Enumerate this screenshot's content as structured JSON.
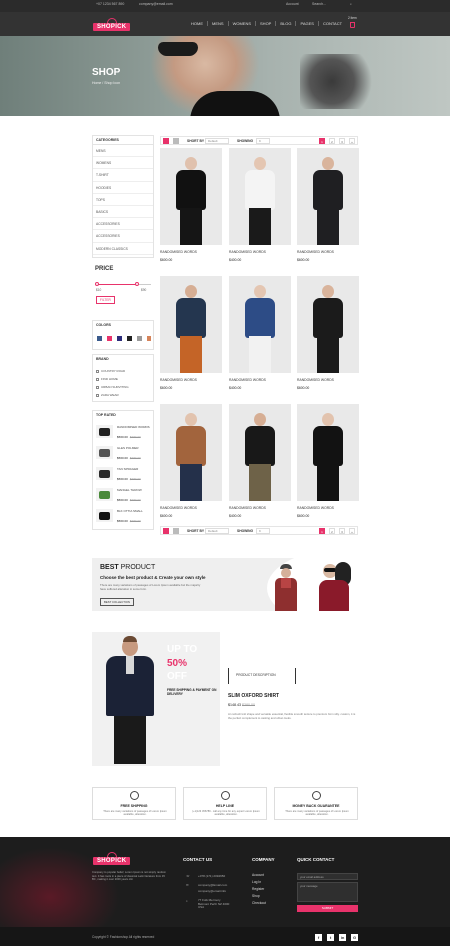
{
  "topbar": {
    "phone": "+07 1234 567 890",
    "email": "company@email.com",
    "account": "Account",
    "search_placeholder": "Search..."
  },
  "header": {
    "logo": "SHOPICK",
    "nav": [
      "HOME",
      "MENS",
      "WOMENS",
      "SHOP",
      "BLOG",
      "PAGES",
      "CONTACT"
    ],
    "cart_count": "2 item"
  },
  "hero": {
    "title": "SHOP",
    "breadcrumb": "Home / Shop Icon"
  },
  "sidebar": {
    "categories_title": "CATEGORIES",
    "categories": [
      "MENS",
      "WOMENS",
      "T-SHIRT",
      "HOODIES",
      "TOPS",
      "BASICS",
      "ACCESSORIES",
      "ACCESSORIES",
      "MODERN CLASSICS"
    ],
    "price_title": "PRICE",
    "price_min": "$10",
    "price_max": "$90",
    "filter_label": "FILTER",
    "colors_title": "COLORS",
    "colors": [
      "#3a5a8c",
      "#e8336b",
      "#2c2c7a",
      "#222222",
      "#9a9a9a",
      "#d5835a"
    ],
    "brand_title": "BRAND",
    "brands": [
      "COUNTRY ROAD",
      "FIND HOME",
      "URBAN SURVITING",
      "ZARA WEAR"
    ],
    "top_rated_title": "TOP RATED",
    "top_rated": [
      {
        "name": "RANDOMISED WORDS",
        "price": "$560.00",
        "old": "$380.00"
      },
      {
        "name": "GLES POLMER",
        "price": "$560.00",
        "old": "$380.00"
      },
      {
        "name": "TAN SPRAGER",
        "price": "$560.00",
        "old": "$380.00"
      },
      {
        "name": "MANGEL THROW",
        "price": "$560.00",
        "old": "$380.00"
      },
      {
        "name": "BLK OTTIA SMALL",
        "price": "$560.00",
        "old": "$380.00"
      }
    ]
  },
  "toolbar": {
    "sort_label": "SHORT BY",
    "sort_value": "Default",
    "show_label": "SHOWING",
    "show_value": "9",
    "pages": [
      "1",
      "2",
      "3",
      "»"
    ]
  },
  "products": [
    {
      "name": "RANDOMISED WORDS",
      "price": "$600.00",
      "body": "#111111",
      "legs": "#151515",
      "skin": "#e0c1ad"
    },
    {
      "name": "RANDOMISED WORDS",
      "price": "$400.00",
      "body": "#f4f4f4",
      "legs": "#1a1a1a",
      "skin": "#e4c6b2"
    },
    {
      "name": "RANDOMISED WORDS",
      "price": "$600.00",
      "body": "#1f1f22",
      "legs": "#1f1f22",
      "skin": "#d9b49c"
    },
    {
      "name": "RANDOMISED WORDS",
      "price": "$600.00",
      "body": "#24364f",
      "legs": "#c46427",
      "skin": "#d6ae94"
    },
    {
      "name": "RANDOMISED WORDS",
      "price": "$400.00",
      "body": "#2d4c86",
      "legs": "#f2f2f2",
      "skin": "#e4c6b2"
    },
    {
      "name": "RANDOMISED WORDS",
      "price": "$600.00",
      "body": "#1b1b1b",
      "legs": "#1b1b1b",
      "skin": "#d9b49c"
    },
    {
      "name": "RANDOMISED WORDS",
      "price": "$600.00",
      "body": "#a2643d",
      "legs": "#24304a",
      "skin": "#e2c3ae"
    },
    {
      "name": "RANDOMISED WORDS",
      "price": "$400.00",
      "body": "#181818",
      "legs": "#6e6248",
      "skin": "#d6ae94"
    },
    {
      "name": "RANDOMISED WORDS",
      "price": "$600.00",
      "body": "#121212",
      "legs": "#121212",
      "skin": "#e2c3ae"
    }
  ],
  "best": {
    "title_bold": "BEST",
    "title_rest": " PRODUCT",
    "subtitle": "Choose the best product & Create your own style",
    "desc": "There are many variations of passages of Lorem Ipsum available but the majority have suffered alteration in some form.",
    "button": "BEST COLLECTION"
  },
  "feature": {
    "up": "UP TO",
    "pct": "50%",
    "off": "OFF",
    "shipping": "FREE SHIPPING & PAYMENT ON DELIVERY",
    "desc_label": "PRODUCT DESCRIPTION",
    "product_name": "SLIM OXFORD SHIRT",
    "price": "$148.43",
    "old_price": "$380.00",
    "text": "An refresh knit shape and versatile essential, flexible smooth texture to premium form silty. custom, it is the perfect complement to casting and urban looks."
  },
  "services": [
    {
      "title": "FREE SHIPPING",
      "desc": "There are many variations of passages of Lorem Ipsum available, alteration."
    },
    {
      "title": "HELP LINE",
      "desc": "(+1)123 456789 - call any time for any expert Lorem Ipsum available, alteration."
    },
    {
      "title": "MONEY BACK GUARANTEE",
      "desc": "There are many variations of passages of Lorem Ipsum available, alteration."
    }
  ],
  "footer": {
    "about": "Company to popular belief, Lorem Ipsum is not simply random text. It has roots in a piece of classical Latin literature from 45 BC, making it over 2000 years old.",
    "contact_title": "CONTACT US",
    "contact": [
      "+078 (171) 2094650",
      "company@Email.com",
      "company@email.info",
      "77 Folk Mermory Belmont Perth NZ 4000 USA"
    ],
    "company_title": "COMPANY",
    "company_links": [
      "Account",
      "Log In",
      "Register",
      "Shop",
      "Checkout"
    ],
    "quick_title": "QUICK CONTACT",
    "email_placeholder": "your email address",
    "message_placeholder": "your message",
    "submit": "SUBMIT",
    "copyright": "Copyright © Fashionshop All rights reserved",
    "socials": [
      "f",
      "t",
      "in",
      "G"
    ]
  }
}
